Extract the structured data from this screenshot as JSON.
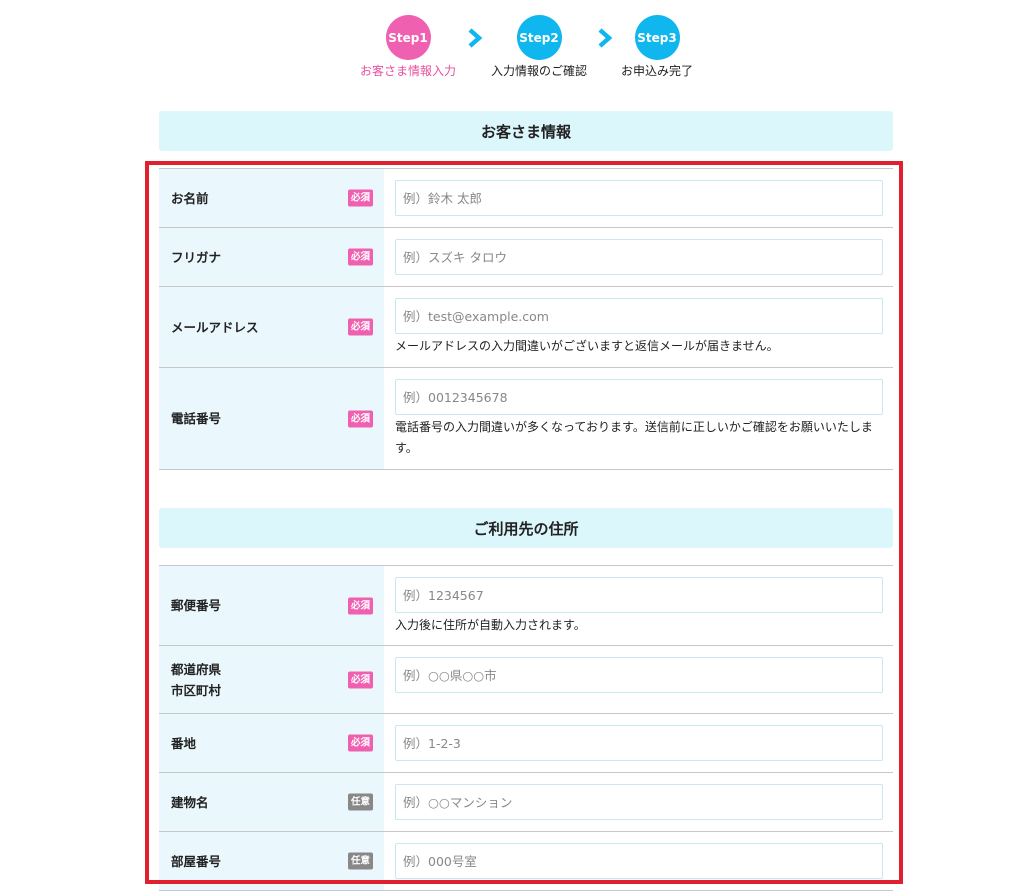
{
  "steps": [
    {
      "badge": "Step1",
      "caption": "お客さま情報入力",
      "state": "active"
    },
    {
      "badge": "Step2",
      "caption": "入力情報のご確認",
      "state": "pending"
    },
    {
      "badge": "Step3",
      "caption": "お申込み完了",
      "state": "pending"
    }
  ],
  "customer_section": {
    "title": "お客さま情報",
    "fields": [
      {
        "label": "お名前",
        "badge": "必須",
        "placeholder": "例）鈴木 太郎"
      },
      {
        "label": "フリガナ",
        "badge": "必須",
        "placeholder": "例）スズキ タロウ"
      },
      {
        "label": "メールアドレス",
        "badge": "必須",
        "placeholder": "例）test@example.com",
        "note": "メールアドレスの入力間違いがございますと返信メールが届きません。"
      },
      {
        "label": "電話番号",
        "badge": "必須",
        "placeholder": "例）0012345678",
        "note": "電話番号の入力間違いが多くなっております。送信前に正しいかご確認をお願いいたします。"
      }
    ]
  },
  "address_section": {
    "title": "ご利用先の住所",
    "fields": [
      {
        "label": "郵便番号",
        "badge": "必須",
        "placeholder": "例）1234567",
        "note": "入力後に住所が自動入力されます。"
      },
      {
        "label_line1": "都道府県",
        "label_line2": "市区町村",
        "badge": "必須",
        "placeholder": "例）○○県○○市"
      },
      {
        "label": "番地",
        "badge": "必須",
        "placeholder": "例）1-2-3"
      },
      {
        "label": "建物名",
        "badge": "任意",
        "placeholder": "例）○○マンション"
      },
      {
        "label": "部屋番号",
        "badge": "任意",
        "placeholder": "例）000号室"
      }
    ]
  },
  "colors": {
    "step_active": "#f060b0",
    "step_pending": "#10b6ee",
    "section_header_bg": "#dcf7fc",
    "label_bg": "#eaf7fd",
    "badge_required": "#f060b0",
    "badge_optional": "#888888",
    "highlight_border": "#e0202e"
  },
  "icons": {
    "step_separator": "chevron-right-icon"
  }
}
